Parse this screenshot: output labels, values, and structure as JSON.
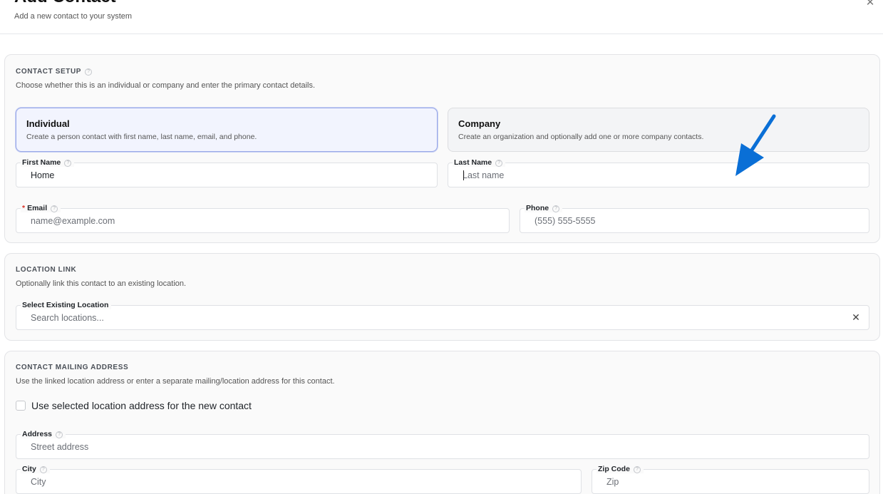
{
  "header": {
    "title": "Add Contact",
    "subtitle": "Add a new contact to your system",
    "close_glyph": "✕"
  },
  "contact_setup": {
    "title": "CONTACT SETUP",
    "description": "Choose whether this is an individual or company and enter the primary contact details.",
    "types": [
      {
        "title": "Individual",
        "description": "Create a person contact with first name, last name, email, and phone.",
        "selected": true
      },
      {
        "title": "Company",
        "description": "Create an organization and optionally add one or more company contacts.",
        "selected": false
      }
    ],
    "first_name": {
      "label": "First Name",
      "value": "Home",
      "placeholder": ""
    },
    "last_name": {
      "label": "Last Name",
      "value": "",
      "placeholder": "Last name"
    },
    "email": {
      "label": "Email",
      "required_mark": "*",
      "value": "",
      "placeholder": "name@example.com"
    },
    "phone": {
      "label": "Phone",
      "value": "",
      "placeholder": "(555) 555-5555"
    }
  },
  "location_link": {
    "title": "LOCATION LINK",
    "description": "Optionally link this contact to an existing location.",
    "select": {
      "label": "Select Existing Location",
      "placeholder": "Search locations...",
      "clear_glyph": "✕"
    }
  },
  "mailing_address": {
    "title": "CONTACT MAILING ADDRESS",
    "description": "Use the linked location address or enter a separate mailing/location address for this contact.",
    "checkbox_label": "Use selected location address for the new contact",
    "address": {
      "label": "Address",
      "placeholder": "Street address"
    },
    "city": {
      "label": "City",
      "placeholder": "City"
    },
    "zip": {
      "label": "Zip Code",
      "placeholder": "Zip"
    }
  },
  "help_glyph": "?",
  "colors": {
    "accent_arrow": "#0a6fd6",
    "selected_card_bg": "#f2f4fe",
    "selected_card_border": "#9aa9e8",
    "required": "#d93025"
  }
}
